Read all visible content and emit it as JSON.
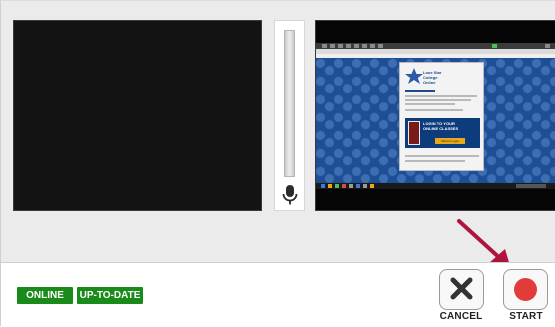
{
  "preview": {
    "mic_level": 0
  },
  "screen_capture": {
    "logo_text": [
      "Lone Star",
      "College",
      "Online"
    ],
    "banner_text": [
      "LOGIN TO YOUR",
      "ONLINE CLASSES"
    ],
    "banner_button": "Mentor Login"
  },
  "status": {
    "online_label": "ONLINE",
    "update_label": "UP-TO-DATE"
  },
  "controls": {
    "cancel_label": "CANCEL",
    "start_label": "START"
  },
  "colors": {
    "badge_green": "#1a8a1a",
    "record_red": "#e33a3a",
    "arrow": "#b0143c"
  },
  "icons": {
    "mic": "microphone-icon",
    "cancel": "close-x-icon",
    "start": "record-dot-icon"
  }
}
